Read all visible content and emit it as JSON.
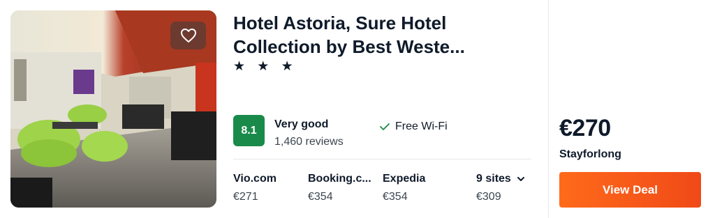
{
  "hotel": {
    "name": "Hotel Astoria, Sure Hotel Collection by Best Weste...",
    "stars": "★ ★ ★",
    "star_rating": 3,
    "favorite_icon": "heart-outline-icon"
  },
  "rating": {
    "score": "8.1",
    "label": "Very good",
    "reviews": "1,460 reviews",
    "badge_color": "#1a8a4a"
  },
  "amenity": {
    "icon": "checkmark-icon",
    "label": "Free Wi-Fi"
  },
  "sites": [
    {
      "name": "Vio.com",
      "price": "€271"
    },
    {
      "name": "Booking.c...",
      "price": "€354"
    },
    {
      "name": "Expedia",
      "price": "€354"
    },
    {
      "name": "9 sites",
      "price": "€309",
      "icon": "chevron-down-icon"
    }
  ],
  "deal": {
    "price": "€270",
    "provider": "Stayforlong",
    "button_label": "View Deal",
    "button_color": "#ff5b1a"
  }
}
